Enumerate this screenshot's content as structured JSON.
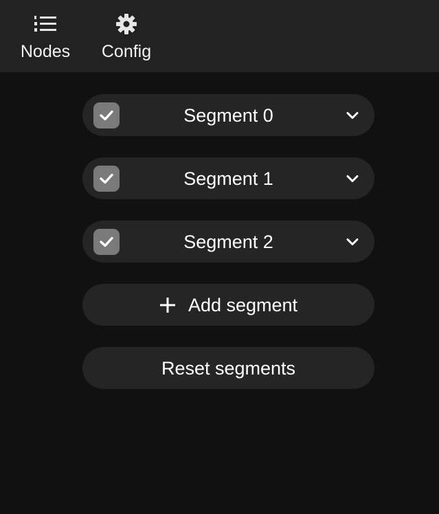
{
  "topbar": {
    "nodes": {
      "label": "Nodes",
      "icon": "list-numbered-icon"
    },
    "config": {
      "label": "Config",
      "icon": "gear-icon"
    }
  },
  "segments": [
    {
      "name": "Segment 0",
      "checked": true
    },
    {
      "name": "Segment 1",
      "checked": true
    },
    {
      "name": "Segment 2",
      "checked": true
    }
  ],
  "actions": {
    "add_segment": "Add segment",
    "reset_segments": "Reset segments"
  },
  "colors": {
    "background": "#111111",
    "topbar": "#222222",
    "pill": "#252525",
    "checkbox": "#7a7a7a",
    "text": "#ffffff"
  }
}
